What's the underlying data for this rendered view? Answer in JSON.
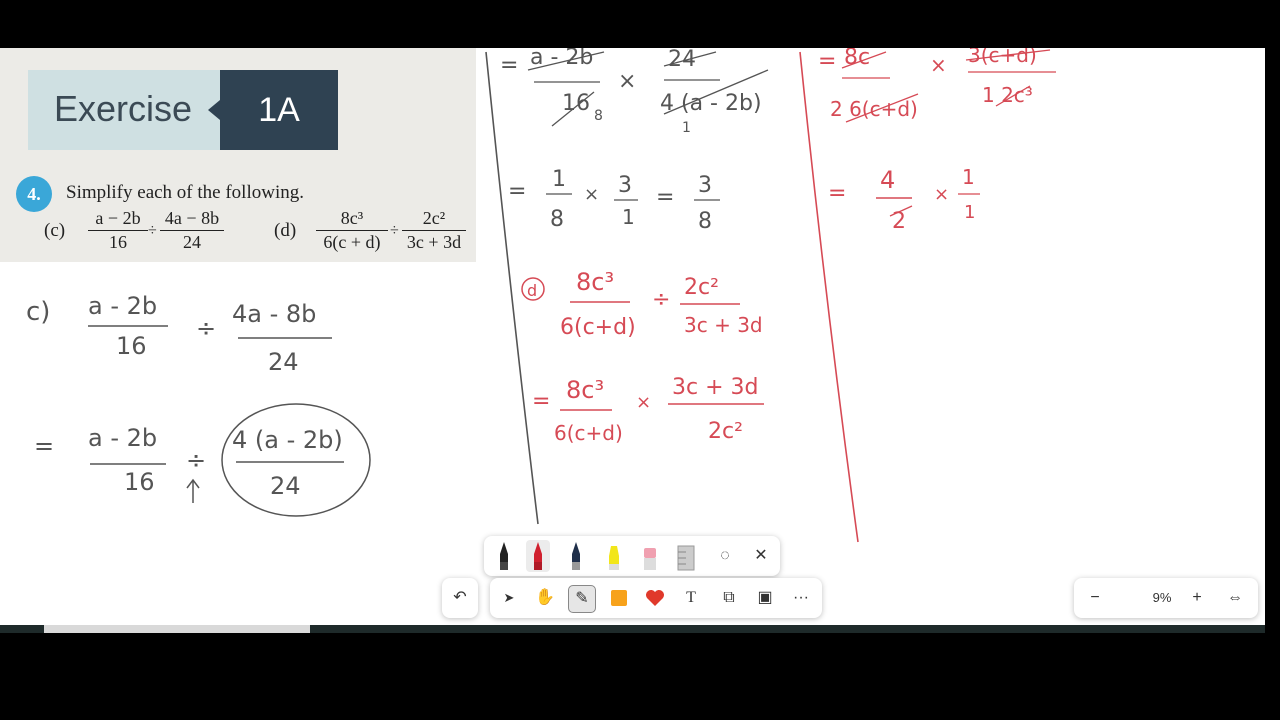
{
  "textbook": {
    "banner_word": "Exercise",
    "banner_number": "1A",
    "question_number": "4.",
    "question_text": "Simplify each of the following.",
    "part_c_label": "(c)",
    "part_c": {
      "num1": "a − 2b",
      "den1": "16",
      "op": "÷",
      "num2": "4a − 8b",
      "den2": "24"
    },
    "part_d_label": "(d)",
    "part_d": {
      "num1": "8c³",
      "den1": "6(c + d)",
      "op": "÷",
      "num2": "2c²",
      "den2": "3c + 3d"
    }
  },
  "handwriting": {
    "c_label": "c)",
    "c_line1": {
      "num1": "a - 2b",
      "den1": "16",
      "op": "÷",
      "num2": "4a - 8b",
      "den2": "24"
    },
    "c_line2": {
      "eq": "=",
      "num1": "a - 2b",
      "den1": "16",
      "op": "÷",
      "num2": "4 (a - 2b)",
      "den2": "24"
    },
    "mid_top": {
      "eq": "=",
      "num1": "a - 2b",
      "den1": "16",
      "den1_sub": "8",
      "op": "×",
      "num2": "24",
      "den2": "4 (a - 2b)",
      "den2_sub": "1"
    },
    "mid_line2": {
      "eq": "=",
      "num1": "1",
      "den1": "8",
      "op": "×",
      "num2": "3",
      "den2": "1",
      "eq2": "=",
      "num3": "3",
      "den3": "8"
    },
    "d_label": "d",
    "d_line1": {
      "num1": "8c³",
      "den1": "6(c+d)",
      "op": "÷",
      "num2": "2c²",
      "den2": "3c + 3d"
    },
    "d_line2": {
      "eq": "=",
      "num1": "8c³",
      "den1": "6(c+d)",
      "op": "×",
      "num2": "3c + 3d",
      "den2": "2c²"
    },
    "right_top": {
      "eq": "=",
      "num1": "8c",
      "den1": "2 6(c+d)",
      "op": "×",
      "num2": "3(c+d)",
      "den2": "1 2c³"
    },
    "right_line2": {
      "eq": "=",
      "num1": "4",
      "den1": "2",
      "op": "×",
      "num2": "1",
      "den2": "1"
    }
  },
  "pens_toolbar": {
    "pens": [
      {
        "name": "black-pen-icon",
        "color": "#222222"
      },
      {
        "name": "red-pen-icon",
        "color": "#d0202e"
      },
      {
        "name": "blue-pen-icon",
        "color": "#1f2f4a"
      },
      {
        "name": "highlighter-yellow-icon",
        "color": "#f2e61a"
      },
      {
        "name": "eraser-icon",
        "color": "#f0a0b0"
      },
      {
        "name": "ruler-icon",
        "color": "#bbbbbb"
      }
    ],
    "lasso_icon": "◌",
    "close_icon": "✕"
  },
  "main_toolbar": {
    "undo_icon": "↶",
    "select_icon": "➤",
    "pan_icon": "✋",
    "ink_icon": "✎",
    "sticky_note_color": "#f7a21b",
    "reaction_color": "#e0392b",
    "text_icon": "T",
    "shapes_icon": "⧉",
    "template_icon": "▣",
    "more_icon": "···"
  },
  "zoom": {
    "zoom_out_icon": "−",
    "value": "9%",
    "zoom_in_icon": "+",
    "fit_icon": "⇔"
  },
  "colors": {
    "red_ink": "#d64a55",
    "grey_ink": "#555555"
  }
}
